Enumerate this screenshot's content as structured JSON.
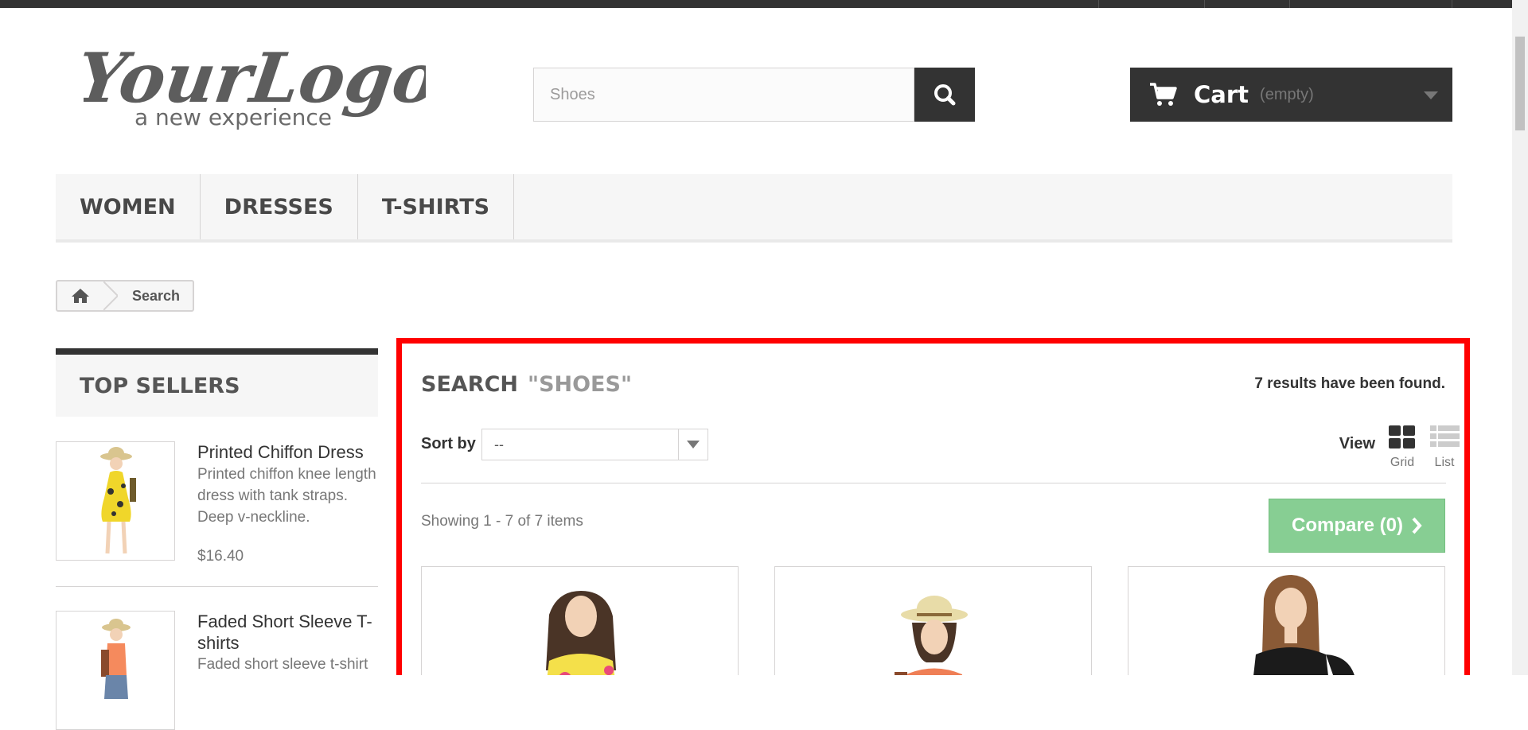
{
  "header": {
    "logo": {
      "title": "YourLogo",
      "tagline": "a new experience"
    },
    "search": {
      "value": "",
      "placeholder": "Shoes",
      "button_icon": "search-icon"
    },
    "cart": {
      "label": "Cart",
      "status": "(empty)",
      "icon": "cart-icon"
    }
  },
  "menu": {
    "items": [
      {
        "label": "WOMEN"
      },
      {
        "label": "DRESSES"
      },
      {
        "label": "T-SHIRTS"
      }
    ]
  },
  "breadcrumb": {
    "home_icon": "home-icon",
    "current": "Search"
  },
  "sidebar": {
    "heading": "TOP SELLERS",
    "items": [
      {
        "name": "Printed Chiffon Dress",
        "description": "Printed chiffon knee length dress with tank straps. Deep v-neckline.",
        "price": "$16.40"
      },
      {
        "name": "Faded Short Sleeve T-shirts",
        "description": "Faded short sleeve t-shirt"
      }
    ]
  },
  "main": {
    "heading": "SEARCH",
    "query": "\"SHOES\"",
    "result_count": "7 results have been found.",
    "sort_label": "Sort by",
    "sort_value": "--",
    "view_label": "View",
    "view_grid": "Grid",
    "view_list": "List",
    "showing": "Showing 1 - 7 of 7 items",
    "compare_label": "Compare (0)"
  },
  "colors": {
    "dark": "#333333",
    "highlight": "#ff0000",
    "compare_green": "#81cc8e"
  }
}
